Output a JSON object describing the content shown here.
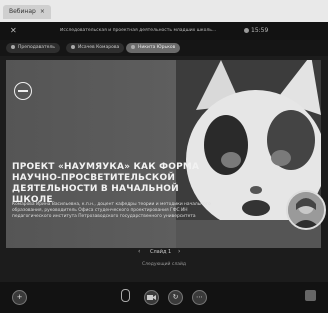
{
  "browser": {
    "tab_label": "Вебинар"
  },
  "meeting": {
    "title": "Исследовательская и проектная деятельность младших школь...",
    "recording_time": "15:59"
  },
  "participants": {
    "chips": [
      {
        "label": "Преподаватель"
      },
      {
        "label": "Исачев Комарова"
      },
      {
        "label": "Никита Юрьков"
      }
    ]
  },
  "slide": {
    "title": "ПРОЕКТ «НАУМЯУКА» КАК ФОРМА НАУЧНО-ПРОСВЕТИТЕЛЬСКОЙ ДЕЯТЕЛЬНОСТИ В НАЧАЛЬНОЙ ШКОЛЕ",
    "author": "Комарова Ирина Васильевна, к.п.н., доцент кафедры теории и методики начального образования, руководитель Офиса студенческого проектирования ГФС ИН педагогического института Петрозаводского государственного университета"
  },
  "pager": {
    "text": "Слайд 1",
    "prev": "‹",
    "next": "›"
  },
  "slides_label": "Следующий слайд",
  "toolbar": {
    "add": "+",
    "share": "↻",
    "more": "⋯"
  }
}
